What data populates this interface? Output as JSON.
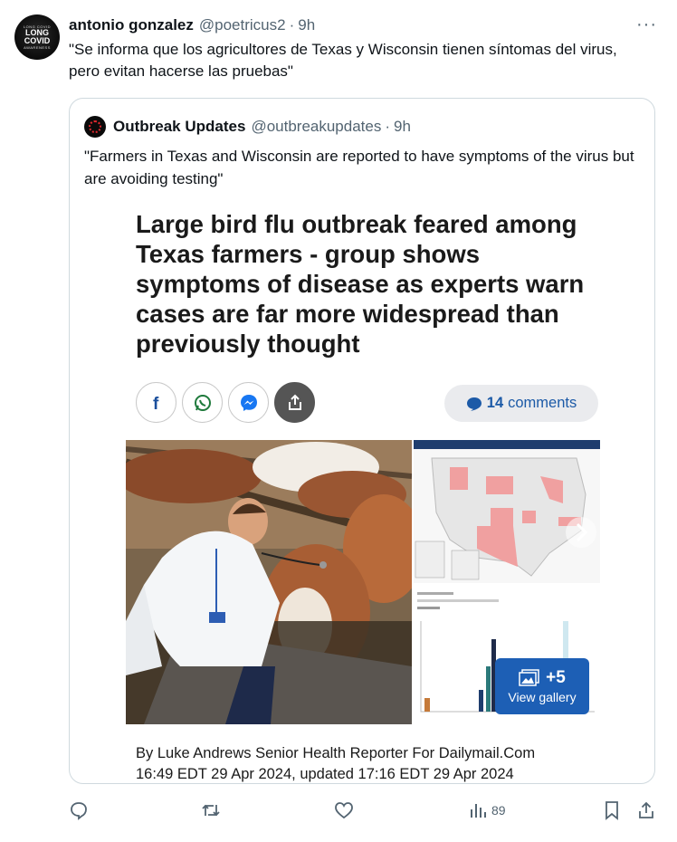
{
  "tweet": {
    "avatar": {
      "ring_top": "LONG COVID",
      "line1": "LONG",
      "line2": "COVID",
      "ring_bottom": "AWARENESS"
    },
    "author_name": "antonio gonzalez",
    "handle": "@poetricus2",
    "separator": "·",
    "time": "9h",
    "more_label": "···",
    "text": "\"Se informa que los agricultores de Texas y Wisconsin tienen síntomas del virus, pero evitan hacerse las pruebas\""
  },
  "quoted": {
    "author_name": "Outbreak Updates",
    "handle": "@outbreakupdates",
    "separator": "·",
    "time": "9h",
    "text": "\"Farmers in Texas and Wisconsin are reported to have symptoms of the virus but are avoiding testing\"",
    "article": {
      "headline": "Large bird flu outbreak feared among Texas farmers - group shows symptoms of disease as experts warn cases are far more widespread than previously thought",
      "share_icons": [
        "facebook-icon",
        "whatsapp-icon",
        "messenger-icon",
        "share-icon"
      ],
      "comments_count": "14",
      "comments_label": "comments",
      "gallery_count": "+5",
      "gallery_label": "View gallery",
      "byline": "By Luke Andrews Senior Health Reporter For Dailymail.Com",
      "dateline": "16:49 EDT 29 Apr 2024, updated 17:16 EDT 29 Apr 2024"
    }
  },
  "actions": {
    "reply_icon": "reply-icon",
    "retweet_icon": "retweet-icon",
    "like_icon": "like-icon",
    "views_icon": "views-icon",
    "views_count": "89",
    "bookmark_icon": "bookmark-icon",
    "share_icon": "share-icon"
  },
  "colors": {
    "text_primary": "#0f1419",
    "text_secondary": "#536471",
    "card_border": "#cfd9de",
    "link_blue": "#1c5aa7",
    "gallery_blue": "#1d5fb5",
    "map_highlight": "#f0a0a0"
  }
}
